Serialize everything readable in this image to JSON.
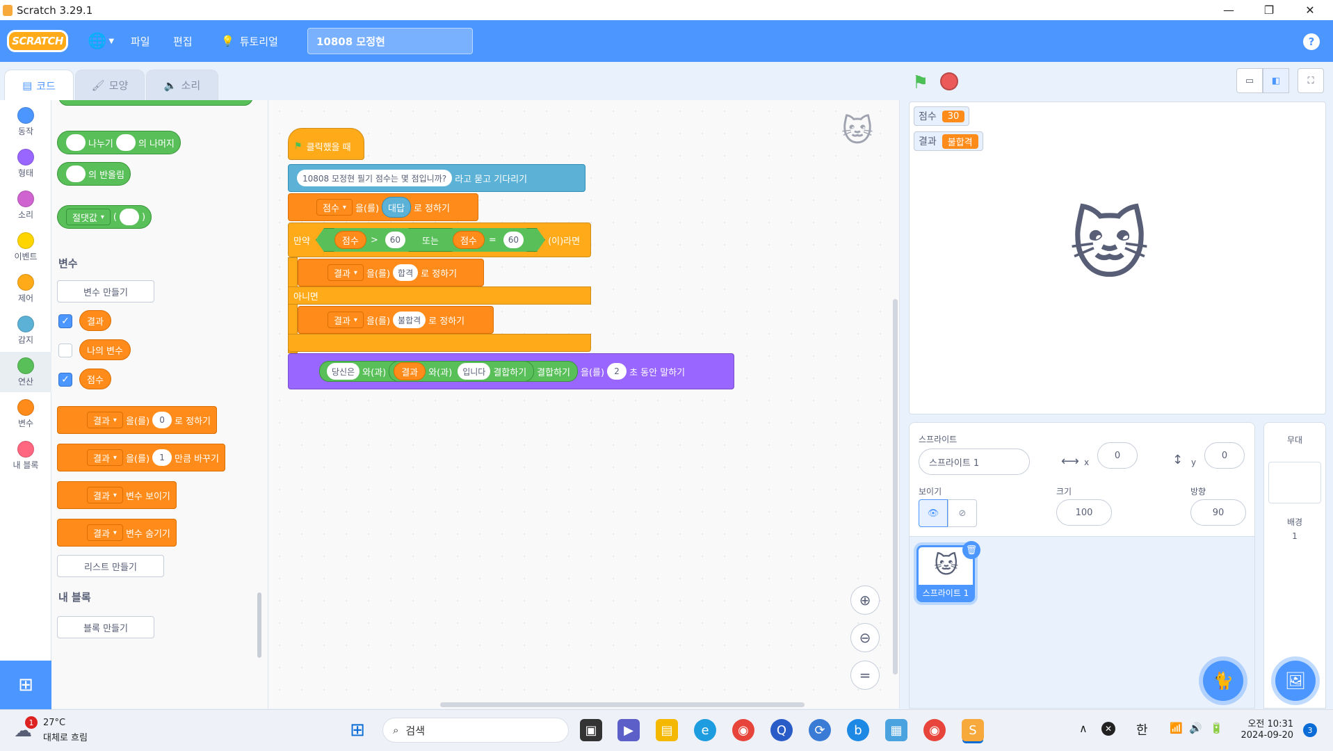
{
  "window": {
    "title": "Scratch 3.29.1"
  },
  "menubar": {
    "logo": "SCRATCH",
    "file": "파일",
    "edit": "편집",
    "tutorials": "튜토리얼",
    "project_title": "10808 모정현",
    "help": "?"
  },
  "tabs": {
    "code": "코드",
    "costumes": "모양",
    "sounds": "소리"
  },
  "categories": [
    {
      "label": "동작",
      "color": "#4c97ff"
    },
    {
      "label": "형태",
      "color": "#9966ff"
    },
    {
      "label": "소리",
      "color": "#cf63cf"
    },
    {
      "label": "이벤트",
      "color": "#ffd500"
    },
    {
      "label": "제어",
      "color": "#ffab19"
    },
    {
      "label": "감지",
      "color": "#5cb1d6"
    },
    {
      "label": "연산",
      "color": "#59c059"
    },
    {
      "label": "변수",
      "color": "#ff8c1a"
    },
    {
      "label": "내 블록",
      "color": "#ff6680"
    }
  ],
  "palette": {
    "mod_block": {
      "text": "나누기",
      "text2": "의 나머지"
    },
    "round_block": {
      "text": "의 반올림"
    },
    "abs_block": {
      "dropdown": "절댓값",
      "paren_open": "(",
      "paren_close": ")"
    },
    "variables_heading": "변수",
    "make_variable": "변수 만들기",
    "vars": [
      {
        "name": "결과",
        "checked": true
      },
      {
        "name": "나의 변수",
        "checked": false
      },
      {
        "name": "점수",
        "checked": true
      }
    ],
    "set_block": {
      "var": "결과",
      "text1": "을(를)",
      "value": "0",
      "text2": "로 정하기"
    },
    "change_block": {
      "var": "결과",
      "text1": "을(를)",
      "value": "1",
      "text2": "만큼 바꾸기"
    },
    "show_block": {
      "var": "결과",
      "text": "변수 보이기"
    },
    "hide_block": {
      "var": "결과",
      "text": "변수 숨기기"
    },
    "make_list": "리스트 만들기",
    "myblocks_heading": "내 블록",
    "make_block": "블록 만들기"
  },
  "script": {
    "hat": "클릭했을 때",
    "ask": {
      "question": "10808 모정현 필기 점수는 몇 점입니까?",
      "text": "라고 묻고 기다리기"
    },
    "set1": {
      "var": "점수",
      "text1": "을(를)",
      "value": "대답",
      "text2": "로 정하기"
    },
    "if": {
      "label": "만약",
      "left_var": "점수",
      "op1": ">",
      "val1": "60",
      "or": "또는",
      "right_var": "점수",
      "op2": "=",
      "val2": "60",
      "then": "(이)라면"
    },
    "set2": {
      "var": "결과",
      "text1": "을(를)",
      "value": "합격",
      "text2": "로 정하기"
    },
    "else": "아니면",
    "set3": {
      "var": "결과",
      "text1": "을(를)",
      "value": "불합격",
      "text2": "로 정하기"
    },
    "say": {
      "s1": "당신은",
      "w1": "와(과)",
      "var": "결과",
      "w2": "와(과)",
      "s2": "입니다",
      "join1": "결합하기",
      "join2": "결합하기",
      "text1": "을(를)",
      "secs": "2",
      "text2": "초 동안 말하기"
    }
  },
  "stage": {
    "monitors": [
      {
        "label": "점수",
        "value": "30"
      },
      {
        "label": "결과",
        "value": "불합격"
      }
    ]
  },
  "sprite_info": {
    "sprite_label": "스프라이트",
    "name": "스프라이트 1",
    "x_label": "x",
    "x": "0",
    "y_label": "y",
    "y": "0",
    "show_label": "보이기",
    "size_label": "크기",
    "size": "100",
    "direction_label": "방향",
    "direction": "90"
  },
  "sprite_list": [
    {
      "name": "스프라이트 1"
    }
  ],
  "stage_panel": {
    "title": "무대",
    "backdrop_label": "배경",
    "backdrop_count": "1"
  },
  "taskbar": {
    "weather_temp": "27°C",
    "weather_desc": "대체로 흐림",
    "weather_badge": "1",
    "search": "검색",
    "lang": "한",
    "time": "오전 10:31",
    "date": "2024-09-20",
    "notif": "3"
  }
}
